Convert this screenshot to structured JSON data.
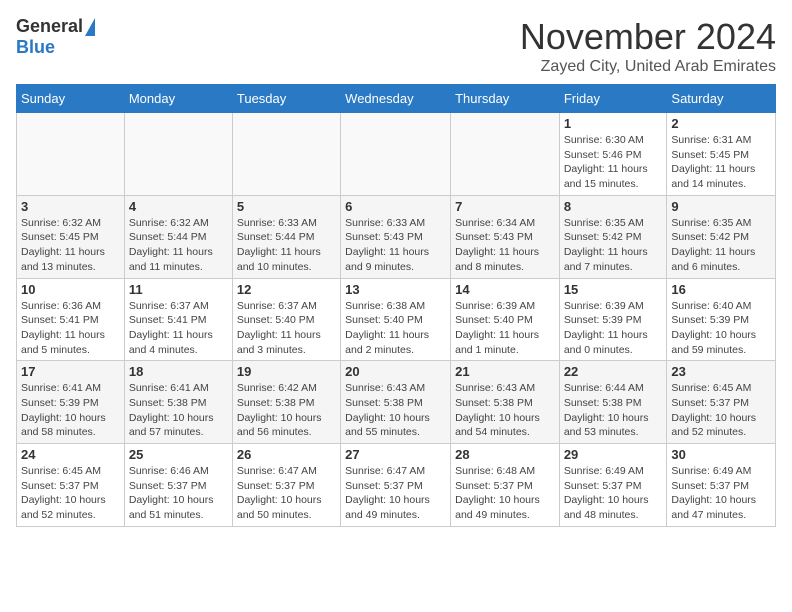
{
  "logo": {
    "general": "General",
    "blue": "Blue"
  },
  "header": {
    "month": "November 2024",
    "location": "Zayed City, United Arab Emirates"
  },
  "days_of_week": [
    "Sunday",
    "Monday",
    "Tuesday",
    "Wednesday",
    "Thursday",
    "Friday",
    "Saturday"
  ],
  "weeks": [
    [
      {
        "day": "",
        "info": ""
      },
      {
        "day": "",
        "info": ""
      },
      {
        "day": "",
        "info": ""
      },
      {
        "day": "",
        "info": ""
      },
      {
        "day": "",
        "info": ""
      },
      {
        "day": "1",
        "info": "Sunrise: 6:30 AM\nSunset: 5:46 PM\nDaylight: 11 hours and 15 minutes."
      },
      {
        "day": "2",
        "info": "Sunrise: 6:31 AM\nSunset: 5:45 PM\nDaylight: 11 hours and 14 minutes."
      }
    ],
    [
      {
        "day": "3",
        "info": "Sunrise: 6:32 AM\nSunset: 5:45 PM\nDaylight: 11 hours and 13 minutes."
      },
      {
        "day": "4",
        "info": "Sunrise: 6:32 AM\nSunset: 5:44 PM\nDaylight: 11 hours and 11 minutes."
      },
      {
        "day": "5",
        "info": "Sunrise: 6:33 AM\nSunset: 5:44 PM\nDaylight: 11 hours and 10 minutes."
      },
      {
        "day": "6",
        "info": "Sunrise: 6:33 AM\nSunset: 5:43 PM\nDaylight: 11 hours and 9 minutes."
      },
      {
        "day": "7",
        "info": "Sunrise: 6:34 AM\nSunset: 5:43 PM\nDaylight: 11 hours and 8 minutes."
      },
      {
        "day": "8",
        "info": "Sunrise: 6:35 AM\nSunset: 5:42 PM\nDaylight: 11 hours and 7 minutes."
      },
      {
        "day": "9",
        "info": "Sunrise: 6:35 AM\nSunset: 5:42 PM\nDaylight: 11 hours and 6 minutes."
      }
    ],
    [
      {
        "day": "10",
        "info": "Sunrise: 6:36 AM\nSunset: 5:41 PM\nDaylight: 11 hours and 5 minutes."
      },
      {
        "day": "11",
        "info": "Sunrise: 6:37 AM\nSunset: 5:41 PM\nDaylight: 11 hours and 4 minutes."
      },
      {
        "day": "12",
        "info": "Sunrise: 6:37 AM\nSunset: 5:40 PM\nDaylight: 11 hours and 3 minutes."
      },
      {
        "day": "13",
        "info": "Sunrise: 6:38 AM\nSunset: 5:40 PM\nDaylight: 11 hours and 2 minutes."
      },
      {
        "day": "14",
        "info": "Sunrise: 6:39 AM\nSunset: 5:40 PM\nDaylight: 11 hours and 1 minute."
      },
      {
        "day": "15",
        "info": "Sunrise: 6:39 AM\nSunset: 5:39 PM\nDaylight: 11 hours and 0 minutes."
      },
      {
        "day": "16",
        "info": "Sunrise: 6:40 AM\nSunset: 5:39 PM\nDaylight: 10 hours and 59 minutes."
      }
    ],
    [
      {
        "day": "17",
        "info": "Sunrise: 6:41 AM\nSunset: 5:39 PM\nDaylight: 10 hours and 58 minutes."
      },
      {
        "day": "18",
        "info": "Sunrise: 6:41 AM\nSunset: 5:38 PM\nDaylight: 10 hours and 57 minutes."
      },
      {
        "day": "19",
        "info": "Sunrise: 6:42 AM\nSunset: 5:38 PM\nDaylight: 10 hours and 56 minutes."
      },
      {
        "day": "20",
        "info": "Sunrise: 6:43 AM\nSunset: 5:38 PM\nDaylight: 10 hours and 55 minutes."
      },
      {
        "day": "21",
        "info": "Sunrise: 6:43 AM\nSunset: 5:38 PM\nDaylight: 10 hours and 54 minutes."
      },
      {
        "day": "22",
        "info": "Sunrise: 6:44 AM\nSunset: 5:38 PM\nDaylight: 10 hours and 53 minutes."
      },
      {
        "day": "23",
        "info": "Sunrise: 6:45 AM\nSunset: 5:37 PM\nDaylight: 10 hours and 52 minutes."
      }
    ],
    [
      {
        "day": "24",
        "info": "Sunrise: 6:45 AM\nSunset: 5:37 PM\nDaylight: 10 hours and 52 minutes."
      },
      {
        "day": "25",
        "info": "Sunrise: 6:46 AM\nSunset: 5:37 PM\nDaylight: 10 hours and 51 minutes."
      },
      {
        "day": "26",
        "info": "Sunrise: 6:47 AM\nSunset: 5:37 PM\nDaylight: 10 hours and 50 minutes."
      },
      {
        "day": "27",
        "info": "Sunrise: 6:47 AM\nSunset: 5:37 PM\nDaylight: 10 hours and 49 minutes."
      },
      {
        "day": "28",
        "info": "Sunrise: 6:48 AM\nSunset: 5:37 PM\nDaylight: 10 hours and 49 minutes."
      },
      {
        "day": "29",
        "info": "Sunrise: 6:49 AM\nSunset: 5:37 PM\nDaylight: 10 hours and 48 minutes."
      },
      {
        "day": "30",
        "info": "Sunrise: 6:49 AM\nSunset: 5:37 PM\nDaylight: 10 hours and 47 minutes."
      }
    ]
  ]
}
